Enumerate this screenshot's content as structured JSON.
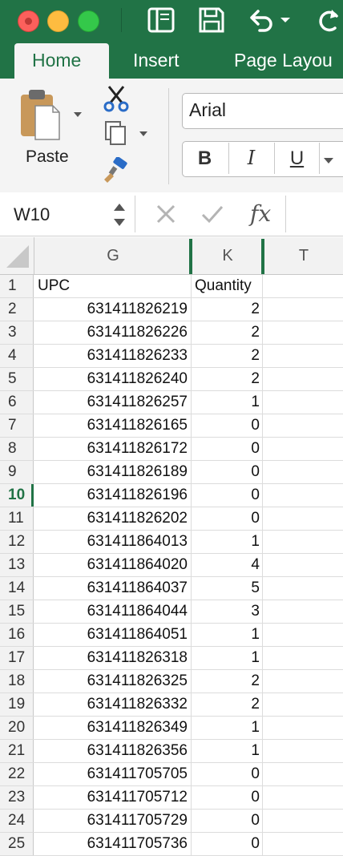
{
  "title_bar": {
    "window_controls": [
      "close",
      "minimize",
      "zoom"
    ],
    "quick_access_icons": [
      "sidebar-icon",
      "save-icon",
      "undo-icon",
      "redo-icon"
    ]
  },
  "tabs": [
    {
      "label": "Home",
      "active": true
    },
    {
      "label": "Insert",
      "active": false
    },
    {
      "label": "Page Layou",
      "active": false
    }
  ],
  "ribbon": {
    "paste_label": "Paste",
    "font_name": "Arial",
    "bold_label": "B",
    "italic_label": "I",
    "underline_label": "U",
    "icons": [
      "paste-icon",
      "cut-icon",
      "copy-icon",
      "format-painter-icon"
    ]
  },
  "formula_bar": {
    "name_box": "W10",
    "fx_label": "fx",
    "formula_value": ""
  },
  "column_headers": [
    "G",
    "K",
    "T"
  ],
  "selected_row": 10,
  "rows": [
    {
      "n": "1",
      "upc": "UPC",
      "qty": "Quantity",
      "header": true
    },
    {
      "n": "2",
      "upc": "631411826219",
      "qty": "2"
    },
    {
      "n": "3",
      "upc": "631411826226",
      "qty": "2"
    },
    {
      "n": "4",
      "upc": "631411826233",
      "qty": "2"
    },
    {
      "n": "5",
      "upc": "631411826240",
      "qty": "2"
    },
    {
      "n": "6",
      "upc": "631411826257",
      "qty": "1"
    },
    {
      "n": "7",
      "upc": "631411826165",
      "qty": "0"
    },
    {
      "n": "8",
      "upc": "631411826172",
      "qty": "0"
    },
    {
      "n": "9",
      "upc": "631411826189",
      "qty": "0"
    },
    {
      "n": "10",
      "upc": "631411826196",
      "qty": "0"
    },
    {
      "n": "11",
      "upc": "631411826202",
      "qty": "0"
    },
    {
      "n": "12",
      "upc": "631411864013",
      "qty": "1"
    },
    {
      "n": "13",
      "upc": "631411864020",
      "qty": "4"
    },
    {
      "n": "14",
      "upc": "631411864037",
      "qty": "5"
    },
    {
      "n": "15",
      "upc": "631411864044",
      "qty": "3"
    },
    {
      "n": "16",
      "upc": "631411864051",
      "qty": "1"
    },
    {
      "n": "17",
      "upc": "631411826318",
      "qty": "1"
    },
    {
      "n": "18",
      "upc": "631411826325",
      "qty": "2"
    },
    {
      "n": "19",
      "upc": "631411826332",
      "qty": "2"
    },
    {
      "n": "20",
      "upc": "631411826349",
      "qty": "1"
    },
    {
      "n": "21",
      "upc": "631411826356",
      "qty": "1"
    },
    {
      "n": "22",
      "upc": "631411705705",
      "qty": "0"
    },
    {
      "n": "23",
      "upc": "631411705712",
      "qty": "0"
    },
    {
      "n": "24",
      "upc": "631411705729",
      "qty": "0"
    },
    {
      "n": "25",
      "upc": "631411705736",
      "qty": "0"
    }
  ],
  "colors": {
    "accent": "#217346",
    "header_bg": "#f2f2f2",
    "ribbon_bg": "#f4f4f4"
  }
}
